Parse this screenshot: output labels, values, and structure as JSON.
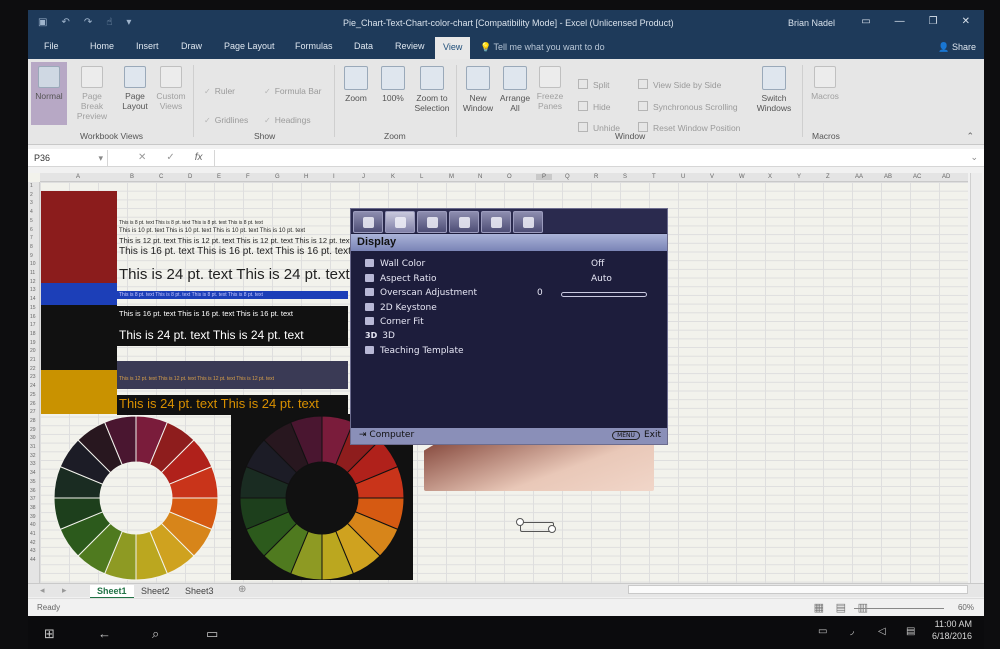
{
  "window": {
    "title": "Pie_Chart-Text-Chart-color-chart  [Compatibility Mode] - Excel (Unlicensed Product)",
    "user": "Brian Nadel"
  },
  "tabs": [
    "File",
    "Home",
    "Insert",
    "Draw",
    "Page Layout",
    "Formulas",
    "Data",
    "Review",
    "View"
  ],
  "tell_me": "Tell me what you want to do",
  "share": "Share",
  "ribbon": {
    "workbook_views": {
      "label": "Workbook Views",
      "normal": "Normal",
      "page_break": "Page Break Preview",
      "page_layout": "Page Layout",
      "custom_views": "Custom Views"
    },
    "show": {
      "label": "Show",
      "ruler": "Ruler",
      "formula_bar": "Formula Bar",
      "gridlines": "Gridlines",
      "headings": "Headings"
    },
    "zoom": {
      "label": "Zoom",
      "zoom": "Zoom",
      "hundred": "100%",
      "zoom_to_selection": "Zoom to Selection"
    },
    "window": {
      "label": "Window",
      "new_window": "New Window",
      "arrange_all": "Arrange All",
      "freeze_panes": "Freeze Panes",
      "split": "Split",
      "hide": "Hide",
      "unhide": "Unhide",
      "view_side": "View Side by Side",
      "sync_scroll": "Synchronous Scrolling",
      "reset_pos": "Reset Window Position",
      "switch_windows": "Switch Windows"
    },
    "macros": {
      "label": "Macros",
      "macros": "Macros"
    }
  },
  "formula_bar": {
    "name_box": "P36",
    "fx": "fx"
  },
  "columns": [
    "A",
    "B",
    "C",
    "D",
    "E",
    "F",
    "G",
    "H",
    "I",
    "J",
    "K",
    "L",
    "M",
    "N",
    "O",
    "P",
    "Q",
    "R",
    "S",
    "T",
    "U",
    "V",
    "W",
    "X",
    "Y",
    "Z",
    "AA",
    "AB",
    "AC",
    "AD"
  ],
  "rows": [
    "1",
    "2",
    "3",
    "4",
    "5",
    "6",
    "7",
    "8",
    "9",
    "10",
    "11",
    "12",
    "13",
    "14",
    "15",
    "16",
    "17",
    "18",
    "19",
    "20",
    "21",
    "22",
    "23",
    "24",
    "25",
    "26",
    "27",
    "28",
    "29",
    "30",
    "31",
    "32",
    "33",
    "34",
    "35",
    "36",
    "37",
    "38",
    "39",
    "40",
    "41",
    "42",
    "43",
    "44"
  ],
  "sheet_text": {
    "t8": "This is 8 pt. text  This is 8 pt. text  This is 8 pt. text  This is 8 pt. text",
    "t10": "This is 10 pt. text   This is 10 pt. text   This is 10 pt. text   This is 10 pt. text",
    "t12": "This is 12 pt. text   This is 12 pt. text   This is 12 pt. text   This is 12 pt. text",
    "t16": "This is 16 pt. text   This is 16 pt. text   This is 16 pt. text",
    "t24": "This is 24 pt. text   This is 24 pt. text"
  },
  "osd": {
    "header": "Display",
    "items": [
      {
        "label": "Wall Color",
        "value": "Off"
      },
      {
        "label": "Aspect Ratio",
        "value": "Auto"
      },
      {
        "label": "Overscan Adjustment",
        "value": "0"
      },
      {
        "label": "2D Keystone",
        "value": ""
      },
      {
        "label": "Corner Fit",
        "value": ""
      },
      {
        "label": "3D",
        "value": ""
      },
      {
        "label": "Teaching Template",
        "value": ""
      }
    ],
    "icon_3d": "3D",
    "footer_left": "Computer",
    "footer_menu": "MENU",
    "footer_right": "Exit"
  },
  "sheets": [
    "Sheet1",
    "Sheet2",
    "Sheet3"
  ],
  "status": {
    "ready": "Ready",
    "zoom": "60%"
  },
  "taskbar": {
    "time": "11:00 AM",
    "date": "6/18/2016"
  },
  "swatch_colors": [
    "#8b1c1c",
    "#1c3fb8",
    "#111111",
    "#c99200"
  ],
  "wheel_colors": [
    "#7a1c3b",
    "#8e1d1d",
    "#b0211b",
    "#c9341a",
    "#d65a12",
    "#d7851a",
    "#cfa21f",
    "#bba71f",
    "#8e9a23",
    "#4f7a1f",
    "#2c5a1c",
    "#1d3f1c",
    "#1a2c22",
    "#1c1c26",
    "#28171f",
    "#4a1630"
  ]
}
